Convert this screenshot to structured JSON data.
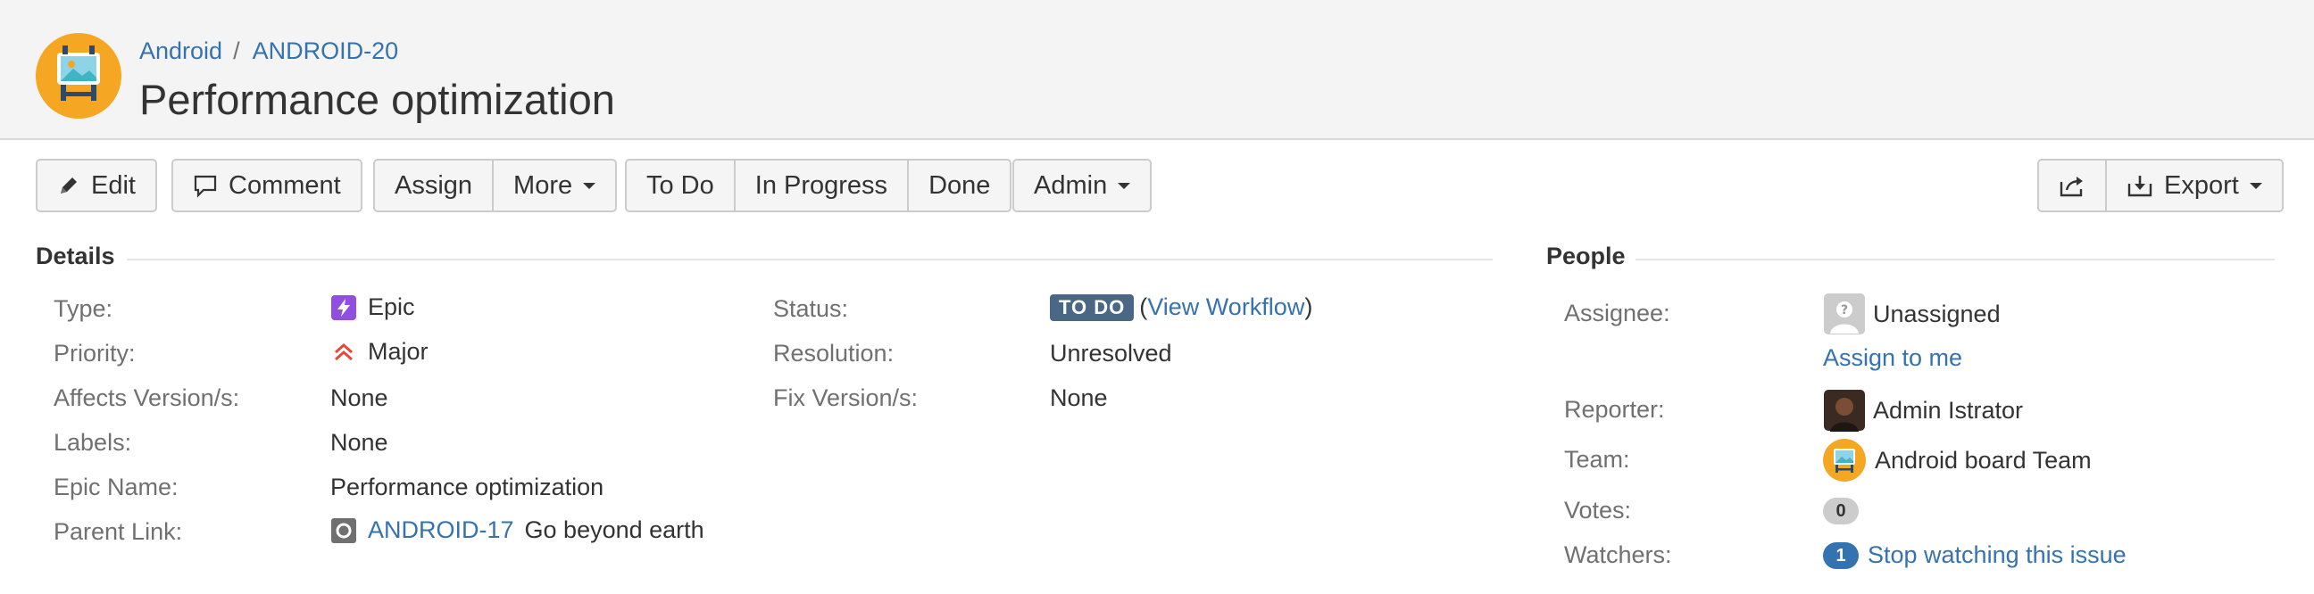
{
  "breadcrumbs": {
    "project": "Android",
    "separator": "/",
    "issue_key": "ANDROID-20"
  },
  "issue": {
    "title": "Performance optimization"
  },
  "toolbar": {
    "edit": "Edit",
    "comment": "Comment",
    "assign": "Assign",
    "more": "More",
    "todo": "To Do",
    "in_progress": "In Progress",
    "done": "Done",
    "admin": "Admin",
    "export": "Export"
  },
  "details": {
    "heading": "Details",
    "left": [
      {
        "label": "Type:",
        "value": "Epic",
        "icon": "epic-icon"
      },
      {
        "label": "Priority:",
        "value": "Major",
        "icon": "priority-major-icon"
      },
      {
        "label": "Affects Version/s:",
        "value": "None"
      },
      {
        "label": "Labels:",
        "value": "None"
      },
      {
        "label": "Epic Name:",
        "value": "Performance optimization"
      },
      {
        "label": "Parent Link:",
        "link": "ANDROID-17",
        "value": "Go beyond earth",
        "icon": "parent-issue-icon"
      }
    ],
    "right": {
      "status_label": "Status:",
      "status_value": "TO DO",
      "status_open_paren": "(",
      "status_link": "View Workflow",
      "status_close_paren": ")",
      "resolution_label": "Resolution:",
      "resolution_value": "Unresolved",
      "fix_label": "Fix Version/s:",
      "fix_value": "None"
    }
  },
  "people": {
    "heading": "People",
    "assignee_label": "Assignee:",
    "assignee_value": "Unassigned",
    "assign_to_me": "Assign to me",
    "reporter_label": "Reporter:",
    "reporter_value": "Admin Istrator",
    "team_label": "Team:",
    "team_value": "Android board Team",
    "votes_label": "Votes:",
    "votes_count": "0",
    "watchers_label": "Watchers:",
    "watchers_count": "1",
    "watch_link": "Stop watching this issue"
  },
  "colors": {
    "link": "#3572b0",
    "status_lozenge": "#4a6785",
    "epic": "#904ee2",
    "priority_major": "#e5493a",
    "avatar_orange": "#f5a623"
  }
}
